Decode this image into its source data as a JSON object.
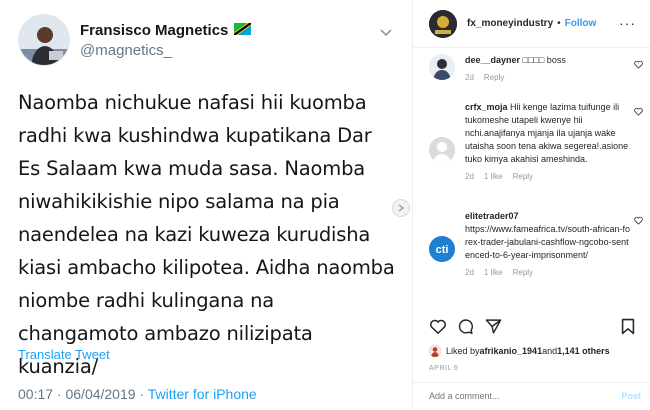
{
  "tweet": {
    "display_name": "Fransisco Magnetics",
    "handle": "@magnetics_",
    "body": "Naomba nichukue nafasi hii kuomba radhi kwa kushindwa kupatikana Dar Es Salaam kwa muda sasa. Naomba niwahikikishie nipo salama na pia naendelea na kazi kuweza kurudisha kiasi ambacho kilipotea. Aidha naomba niombe radhi kulingana na changamoto ambazo nilizipata kuanzia/",
    "translate_label": "Translate Tweet",
    "timestamp": "00:17 · 06/04/2019 · ",
    "source": "Twitter for iPhone",
    "flag_colors": {
      "green": "#1eb53a",
      "blue": "#00a3dd",
      "yellow": "#fcd116",
      "black": "#000000"
    }
  },
  "instagram": {
    "username": "fx_moneyindustry",
    "dot": "•",
    "follow_label": "Follow",
    "more_label": "···",
    "comments": [
      {
        "user": "dee__dayner",
        "text": "□□□□ boss",
        "age": "2d",
        "likes": "",
        "reply": "Reply"
      },
      {
        "user": "crfx_moja",
        "text": "Hii kenge lazima tuifunge ili tukomeshe utapeli kwenye hii nchi.anajifanya mjanja ila ujanja wake utaisha soon tena akiwa segerea!.asione tuko kimya akahisi ameshinda.",
        "age": "2d",
        "likes": "1 like",
        "reply": "Reply"
      },
      {
        "user": "elitetrader07",
        "text": "https://www.fameafrica.tv/south-african-forex-trader-jabulani-cashflow-ngcobo-sentenced-to-6-year-imprisonment/",
        "age": "2d",
        "likes": "1 like",
        "reply": "Reply"
      }
    ],
    "liked_by_prefix": "Liked by ",
    "liked_by_user": "afrikanio_1941",
    "liked_by_mid": " and ",
    "liked_by_count": "1,141 others",
    "date": "APRIL 6",
    "comment_placeholder": "Add a comment...",
    "post_label": "Post",
    "accent": "#3897f0"
  }
}
